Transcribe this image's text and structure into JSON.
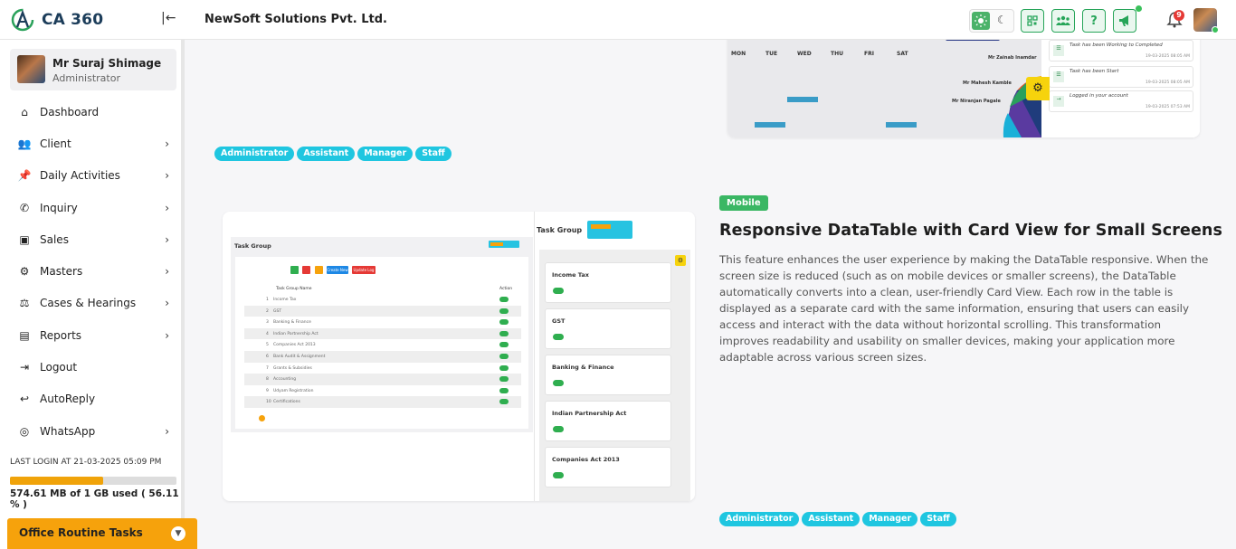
{
  "app": {
    "logo_text": "CA 360",
    "company": "NewSoft Solutions Pvt. Ltd."
  },
  "header": {
    "notification_count": "9",
    "accent": "#27a559"
  },
  "profile": {
    "name": "Mr Suraj Shimage",
    "role": "Administrator"
  },
  "menu": [
    {
      "label": "Dashboard",
      "icon": "home-icon",
      "has_children": false
    },
    {
      "label": "Client",
      "icon": "users-icon",
      "has_children": true
    },
    {
      "label": "Daily Activities",
      "icon": "pin-icon",
      "has_children": true
    },
    {
      "label": "Inquiry",
      "icon": "phone-icon",
      "has_children": true
    },
    {
      "label": "Sales",
      "icon": "money-icon",
      "has_children": true
    },
    {
      "label": "Masters",
      "icon": "gears-icon",
      "has_children": true
    },
    {
      "label": "Cases & Hearings",
      "icon": "scale-icon",
      "has_children": true
    },
    {
      "label": "Reports",
      "icon": "file-icon",
      "has_children": true
    },
    {
      "label": "Logout",
      "icon": "logout-icon",
      "has_children": false
    },
    {
      "label": "AutoReply",
      "icon": "reply-icon",
      "has_children": false
    },
    {
      "label": "WhatsApp",
      "icon": "whatsapp-icon",
      "has_children": true
    }
  ],
  "footer": {
    "last_login": "LAST LOGIN AT 21-03-2025 05:09 PM",
    "storage_text": "574.61 MB of 1 GB used ( 56.11 % )",
    "storage_fraction": 0.5611,
    "office_tasks": "Office Routine Tasks"
  },
  "tags_top": [
    "Administrator",
    "Assistant",
    "Manager",
    "Staff"
  ],
  "feature": {
    "badge": "Mobile",
    "title": "Responsive DataTable with Card View for Small Screens",
    "description": "This feature enhances the user experience by making the DataTable responsive. When the screen size is reduced (such as on mobile devices or smaller screens), the DataTable automatically converts into a clean, user-friendly Card View. Each row in the table is displayed as a separate card with the same information, ensuring that users can easily access and interact with the data without horizontal scrolling. This transformation improves readability and usability on smaller devices, making your application more adaptable across various screen sizes.",
    "tags": [
      "Administrator",
      "Assistant",
      "Manager",
      "Staff"
    ]
  },
  "preview_top": {
    "weekdays": [
      "MON",
      "TUE",
      "WED",
      "THU",
      "FRI",
      "SAT"
    ],
    "feed": [
      {
        "text": "Task has been Working to Completed",
        "date": "19-03-2025 08:05 AM"
      },
      {
        "text": "Task has been Start",
        "date": "19-03-2025 08:05 AM"
      },
      {
        "text": "Logged in your account",
        "date": "19-03-2025 07:53 AM"
      }
    ],
    "people": [
      "Mr Zainab Inamdar",
      "Mr Mahesh Kamble",
      "Mr Niranjan Pagale"
    ]
  },
  "preview_main": {
    "table_title": "Task Group",
    "table_columns": [
      "#",
      "Task Group Name",
      "Action"
    ],
    "rows": [
      "Income Tax",
      "GST",
      "Banking & Finance",
      "Indian Partnership Act",
      "Companies Act 2013",
      "Bank Audit & Assignment",
      "Grants & Subsidies",
      "Accounting",
      "Udyam Registration",
      "Certifications"
    ],
    "create_label": "Create New",
    "update_label": "Update Log",
    "cards_title": "Task Group",
    "cards": [
      "Income Tax",
      "GST",
      "Banking & Finance",
      "Indian Partnership Act",
      "Companies Act 2013"
    ]
  }
}
